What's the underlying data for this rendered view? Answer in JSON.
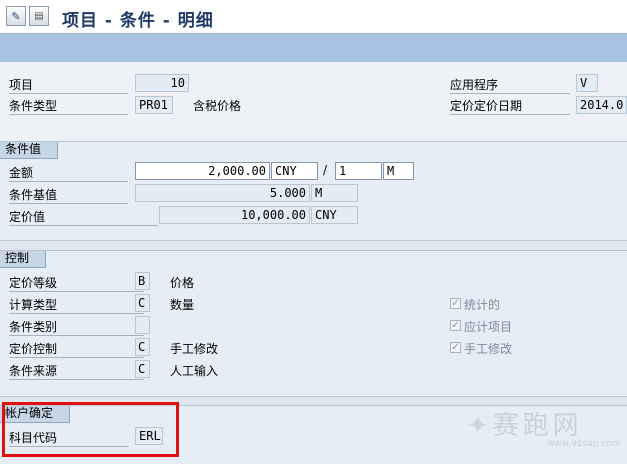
{
  "window": {
    "title": "项目 - 条件 - 明细"
  },
  "header": {
    "item_label": "项目",
    "item_value": "10",
    "cond_type_label": "条件类型",
    "cond_type_value": "PR01",
    "cond_type_desc": "含税价格",
    "application_label": "应用程序",
    "application_value": "V",
    "pricing_date_label": "定价定价日期",
    "pricing_date_value": "2014.0"
  },
  "condition_values": {
    "title": "条件值",
    "amount_label": "金额",
    "amount_value": "2,000.00",
    "amount_currency": "CNY",
    "per_symbol": "/",
    "per_value": "1",
    "per_unit": "M",
    "base_label": "条件基值",
    "base_value": "5.000",
    "base_unit": "M",
    "price_label": "定价值",
    "price_value": "10,000.00",
    "price_currency": "CNY"
  },
  "control": {
    "title": "控制",
    "rows": [
      {
        "label": "定价等级",
        "code": "B",
        "desc": "价格"
      },
      {
        "label": "计算类型",
        "code": "C",
        "desc": "数量"
      },
      {
        "label": "条件类别",
        "code": "",
        "desc": ""
      },
      {
        "label": "定价控制",
        "code": "C",
        "desc": "手工修改"
      },
      {
        "label": "条件来源",
        "code": "C",
        "desc": "人工输入"
      }
    ],
    "checkboxes": [
      {
        "label": "统计的",
        "checked": true
      },
      {
        "label": "应计项目",
        "checked": true
      },
      {
        "label": "手工修改",
        "checked": true
      }
    ]
  },
  "account": {
    "title": "帐户确定",
    "gl_code_label": "科目代码",
    "gl_code_value": "ERL"
  },
  "watermark": {
    "text": "赛跑网",
    "url": "www.91sap.com"
  }
}
